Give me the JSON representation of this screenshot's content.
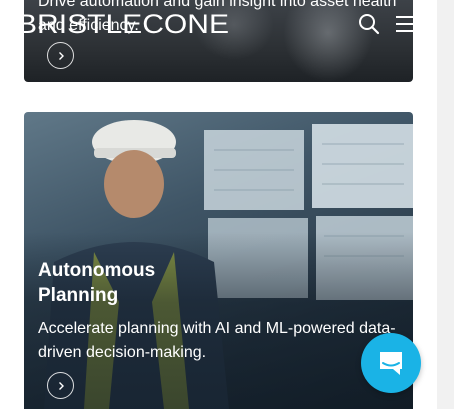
{
  "header": {
    "logo_text": "BRISTLECONE",
    "search_icon": "search-icon",
    "menu_icon": "hamburger-menu-icon"
  },
  "cards": [
    {
      "description": "Drive automation and gain insight into asset health and efficiency.",
      "arrow_icon": "chevron-right-icon"
    },
    {
      "title": "Autonomous Planning",
      "description": "Accelerate planning with AI and ML-powered data-driven decision-making.",
      "arrow_icon": "chevron-right-icon"
    }
  ],
  "chat_widget": {
    "icon": "chat-bubble-icon",
    "color": "#1ab3e6"
  },
  "colors": {
    "text_on_image": "#ffffff",
    "accent": "#1ab3e6"
  }
}
